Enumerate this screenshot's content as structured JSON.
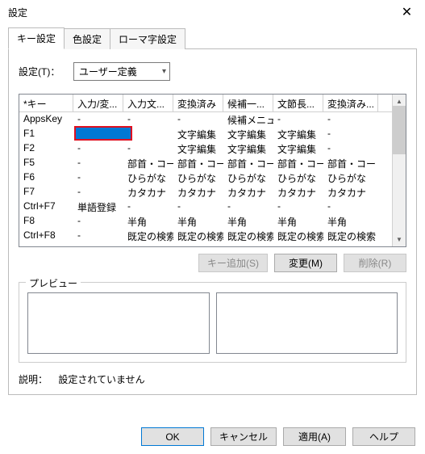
{
  "window": {
    "title": "設定"
  },
  "tabs": [
    {
      "label": "キー設定",
      "active": true
    },
    {
      "label": "色設定",
      "active": false
    },
    {
      "label": "ローマ字設定",
      "active": false
    }
  ],
  "setting": {
    "label": "設定(T)：",
    "select_value": "ユーザー定義"
  },
  "columns": [
    "*キー",
    "入力/変...",
    "入力文...",
    "変換済み",
    "候補一...",
    "文節長...",
    "変換済み..."
  ],
  "rows": [
    {
      "key": "AppsKey",
      "c": [
        "-",
        "-",
        "-",
        "候補メニュー",
        "-",
        "-"
      ]
    },
    {
      "key": "F1",
      "c": [
        "",
        "-",
        "文字編集",
        "文字編集",
        "文字編集",
        "-"
      ],
      "hl_col": 1
    },
    {
      "key": "F2",
      "c": [
        "-",
        "-",
        "文字編集",
        "文字編集",
        "文字編集",
        "-"
      ]
    },
    {
      "key": "F5",
      "c": [
        "-",
        "部首・コード変",
        "部首・コード変",
        "部首・コード変",
        "部首・コード変",
        "部首・コード変"
      ]
    },
    {
      "key": "F6",
      "c": [
        "-",
        "ひらがな",
        "ひらがな",
        "ひらがな",
        "ひらがな",
        "ひらがな"
      ]
    },
    {
      "key": "F7",
      "c": [
        "-",
        "カタカナ",
        "カタカナ",
        "カタカナ",
        "カタカナ",
        "カタカナ"
      ]
    },
    {
      "key": "Ctrl+F7",
      "c": [
        "単語登録",
        "-",
        "-",
        "-",
        "-",
        "-"
      ]
    },
    {
      "key": "F8",
      "c": [
        "-",
        "半角",
        "半角",
        "半角",
        "半角",
        "半角"
      ]
    },
    {
      "key": "Ctrl+F8",
      "c": [
        "-",
        "既定の検索",
        "既定の検索",
        "既定の検索",
        "既定の検索",
        "既定の検索"
      ]
    }
  ],
  "buttons": {
    "add": "キー追加(S)",
    "change": "変更(M)",
    "delete": "削除(R)"
  },
  "preview": {
    "legend": "プレビュー"
  },
  "explain": {
    "label": "説明：",
    "text": "設定されていません"
  },
  "dialog_buttons": {
    "ok": "OK",
    "cancel": "キャンセル",
    "apply": "適用(A)",
    "help": "ヘルプ"
  }
}
